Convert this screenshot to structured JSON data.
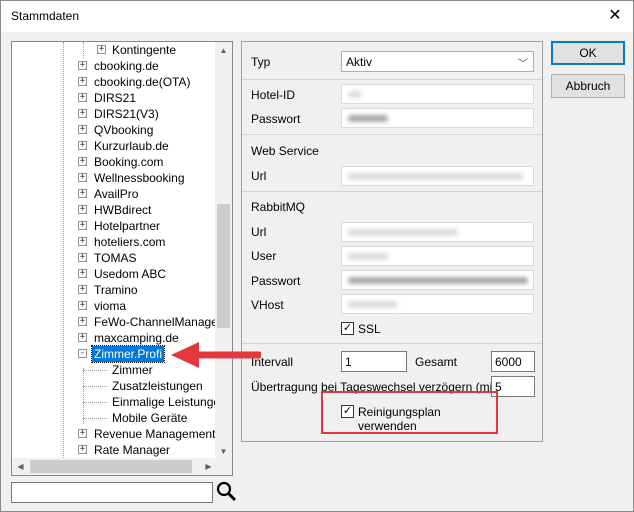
{
  "window": {
    "title": "Stammdaten",
    "close_glyph": "✕"
  },
  "tree": {
    "items": [
      {
        "label": "Kontingente",
        "level": 2,
        "expander": "+"
      },
      {
        "label": "cbooking.de",
        "level": 1,
        "expander": "+"
      },
      {
        "label": "cbooking.de(OTA)",
        "level": 1,
        "expander": "+"
      },
      {
        "label": "DIRS21",
        "level": 1,
        "expander": "+"
      },
      {
        "label": "DIRS21(V3)",
        "level": 1,
        "expander": "+"
      },
      {
        "label": "QVbooking",
        "level": 1,
        "expander": "+"
      },
      {
        "label": "Kurzurlaub.de",
        "level": 1,
        "expander": "+"
      },
      {
        "label": "Booking.com",
        "level": 1,
        "expander": "+"
      },
      {
        "label": "Wellnessbooking",
        "level": 1,
        "expander": "+"
      },
      {
        "label": "AvailPro",
        "level": 1,
        "expander": "+"
      },
      {
        "label": "HWBdirect",
        "level": 1,
        "expander": "+"
      },
      {
        "label": "Hotelpartner",
        "level": 1,
        "expander": "+"
      },
      {
        "label": "hoteliers.com",
        "level": 1,
        "expander": "+"
      },
      {
        "label": "TOMAS",
        "level": 1,
        "expander": "+"
      },
      {
        "label": "Usedom ABC",
        "level": 1,
        "expander": "+"
      },
      {
        "label": "Tramino",
        "level": 1,
        "expander": "+"
      },
      {
        "label": "vioma",
        "level": 1,
        "expander": "+"
      },
      {
        "label": "FeWo-ChannelManager",
        "level": 1,
        "expander": "+"
      },
      {
        "label": "maxcamping.de",
        "level": 1,
        "expander": "+"
      },
      {
        "label": "Zimmer.Profi",
        "level": 1,
        "expander": "-",
        "selected": true
      },
      {
        "label": "Zimmer",
        "level": 2,
        "expander": ""
      },
      {
        "label": "Zusatzleistungen",
        "level": 2,
        "expander": ""
      },
      {
        "label": "Einmalige Leistungen",
        "level": 2,
        "expander": ""
      },
      {
        "label": "Mobile Geräte",
        "level": 2,
        "expander": ""
      },
      {
        "label": "Revenue Management Sy",
        "level": 1,
        "expander": "+"
      },
      {
        "label": "Rate Manager",
        "level": 1,
        "expander": "+"
      }
    ],
    "search_value": ""
  },
  "panel": {
    "typ_label": "Typ",
    "typ_value": "Aktiv",
    "hotelid_label": "Hotel-ID",
    "passwort_label": "Passwort",
    "webservice_label": "Web Service",
    "url_label": "Url",
    "rabbitmq_label": "RabbitMQ",
    "rabbit_url_label": "Url",
    "user_label": "User",
    "rabbit_passwort_label": "Passwort",
    "vhost_label": "VHost",
    "ssl_label": "SSL",
    "ssl_checked": true,
    "intervall_label": "Intervall",
    "intervall_value": "1",
    "gesamt_label": "Gesamt",
    "gesamt_value": "6000",
    "uebertragung_label": "Übertragung bei Tageswechsel verzögern (min)",
    "uebertragung_value": "5",
    "reinigung_label": "Reinigungsplan verwenden",
    "reinigung_checked": true
  },
  "buttons": {
    "ok": "OK",
    "abbruch": "Abbruch"
  },
  "annotation": {
    "highlight_color": "#e4383f",
    "arrow_color": "#e4383f"
  }
}
